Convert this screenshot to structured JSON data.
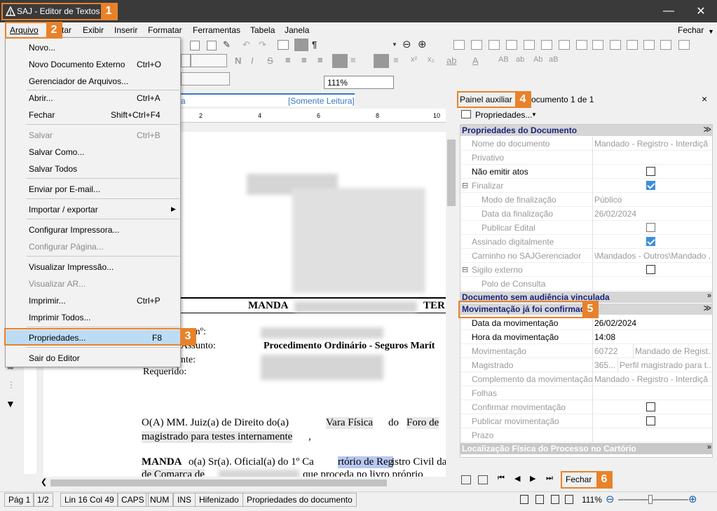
{
  "window": {
    "title": "SAJ - Editor de Textos"
  },
  "menubar": {
    "items": [
      "Arquivo",
      "tar",
      "Exibir",
      "Inserir",
      "Formatar",
      "Ferramentas",
      "Tabela",
      "Janela"
    ],
    "right": "Fechar"
  },
  "toolbar": {
    "zoom": "111%"
  },
  "callouts": [
    "1",
    "2",
    "3",
    "4",
    "5",
    "6"
  ],
  "file_menu": {
    "items": [
      {
        "label": "Novo...",
        "shortcut": ""
      },
      {
        "label": "Novo Documento Externo",
        "shortcut": "Ctrl+O"
      },
      {
        "label": "Gerenciador de Arquivos...",
        "shortcut": ""
      },
      {
        "label": "Abrir...",
        "shortcut": "Ctrl+A"
      },
      {
        "label": "Fechar",
        "shortcut": "Shift+Ctrl+F4"
      },
      {
        "label": "Salvar",
        "shortcut": "Ctrl+B"
      },
      {
        "label": "Salvar Como...",
        "shortcut": ""
      },
      {
        "label": "Salvar Todos",
        "shortcut": ""
      },
      {
        "label": "Enviar por E-mail...",
        "shortcut": ""
      },
      {
        "label": "Importar / exportar",
        "shortcut": ""
      },
      {
        "label": "Configurar Impressora...",
        "shortcut": ""
      },
      {
        "label": "Configurar Página...",
        "shortcut": ""
      },
      {
        "label": "Visualizar Impressão...",
        "shortcut": ""
      },
      {
        "label": "Visualizar AR...",
        "shortcut": ""
      },
      {
        "label": "Imprimir...",
        "shortcut": "Ctrl+P"
      },
      {
        "label": "Imprimir Todos...",
        "shortcut": ""
      },
      {
        "label": "Propriedades...",
        "shortcut": "F8"
      },
      {
        "label": "Sair do Editor",
        "shortcut": ""
      }
    ]
  },
  "document": {
    "tab_tail": "a",
    "tab_readonly": "[Somente Leitura]",
    "ruler_ticks": [
      "2",
      "4",
      "6",
      "8",
      "10"
    ],
    "heading_left": "MANDA",
    "heading_right": "TER",
    "field_labels": [
      "ico nº:",
      "Assunto:",
      "nte:",
      "Requerido:"
    ],
    "assunto_value": "Procedimento Ordinário - Seguros Marít",
    "para1_line1": [
      "O(A) MM. Juiz(a) de Direito do(a)",
      "Vara Física",
      "do",
      "Foro de"
    ],
    "para1_line2": "magistrado para testes internamente",
    "para2_line1": [
      "MANDA",
      "o(a) Sr(a). Oficial(a) do 1º Ca",
      "rtório de Reg",
      "istro Civil da"
    ],
    "para2_line2": [
      "de Comarca de",
      "que proceda no livro próprio"
    ]
  },
  "panel": {
    "title": "Painel auxiliar",
    "subtitle": "ocumento 1 de 1",
    "close": "×",
    "properties_button": "Propriedades...",
    "sections": {
      "documento": "Propriedades do Documento",
      "audiencia": "Documento sem audiência vinculada",
      "movimentacao": "Movimentação já foi confirmada",
      "localizacao": "Localização Física do Processo no Cartório"
    },
    "doc_rows": {
      "nome_label": "Nome do documento",
      "nome_value": "Mandado - Registro - Interdiçã",
      "privativo": "Privativo",
      "nao_emitir": "Não emitir atos",
      "finalizar": "Finalizar",
      "modo_label": "Modo de finalização",
      "modo_value": "Público",
      "data_fin_label": "Data da finalização",
      "data_fin_value": "26/02/2024",
      "publicar_edital": "Publicar Edital",
      "assinado": "Assinado digitalmente",
      "caminho_label": "Caminho no SAJGerenciador",
      "caminho_value": "\\Mandados - Outros\\Mandado ...",
      "sigilo": "Sigilo externo",
      "polo": "Polo de Consulta"
    },
    "mov_rows": {
      "data_label": "Data da movimentação",
      "data_value": "26/02/2024",
      "hora_label": "Hora da movimentação",
      "hora_value": "14:08",
      "mov_label": "Movimentação",
      "mov_code": "60722",
      "mov_value": "Mandado de Regist...",
      "mag_label": "Magistrado",
      "mag_code": "365...",
      "mag_value": "Perfil magistrado para t...",
      "comp_label": "Complemento da movimentação",
      "comp_value": "Mandado - Registro - Interdiçã",
      "folhas": "Folhas",
      "confirmar": "Confirmar movimentação",
      "publicar": "Publicar movimentação",
      "prazo": "Prazo"
    },
    "footer_close": "Fechar"
  },
  "status": {
    "page": "Pág 1",
    "of": "1/2",
    "pos": "Lin 16  Col 49",
    "caps": "CAPS",
    "num": "NUM",
    "ins": "INS",
    "hyph": "Hifenizado",
    "msg": "Propriedades do documento",
    "zoom": "111%"
  },
  "colors": {
    "callout": "#e8822a",
    "section_title": "#1a237e",
    "check": "#3c8edb"
  }
}
